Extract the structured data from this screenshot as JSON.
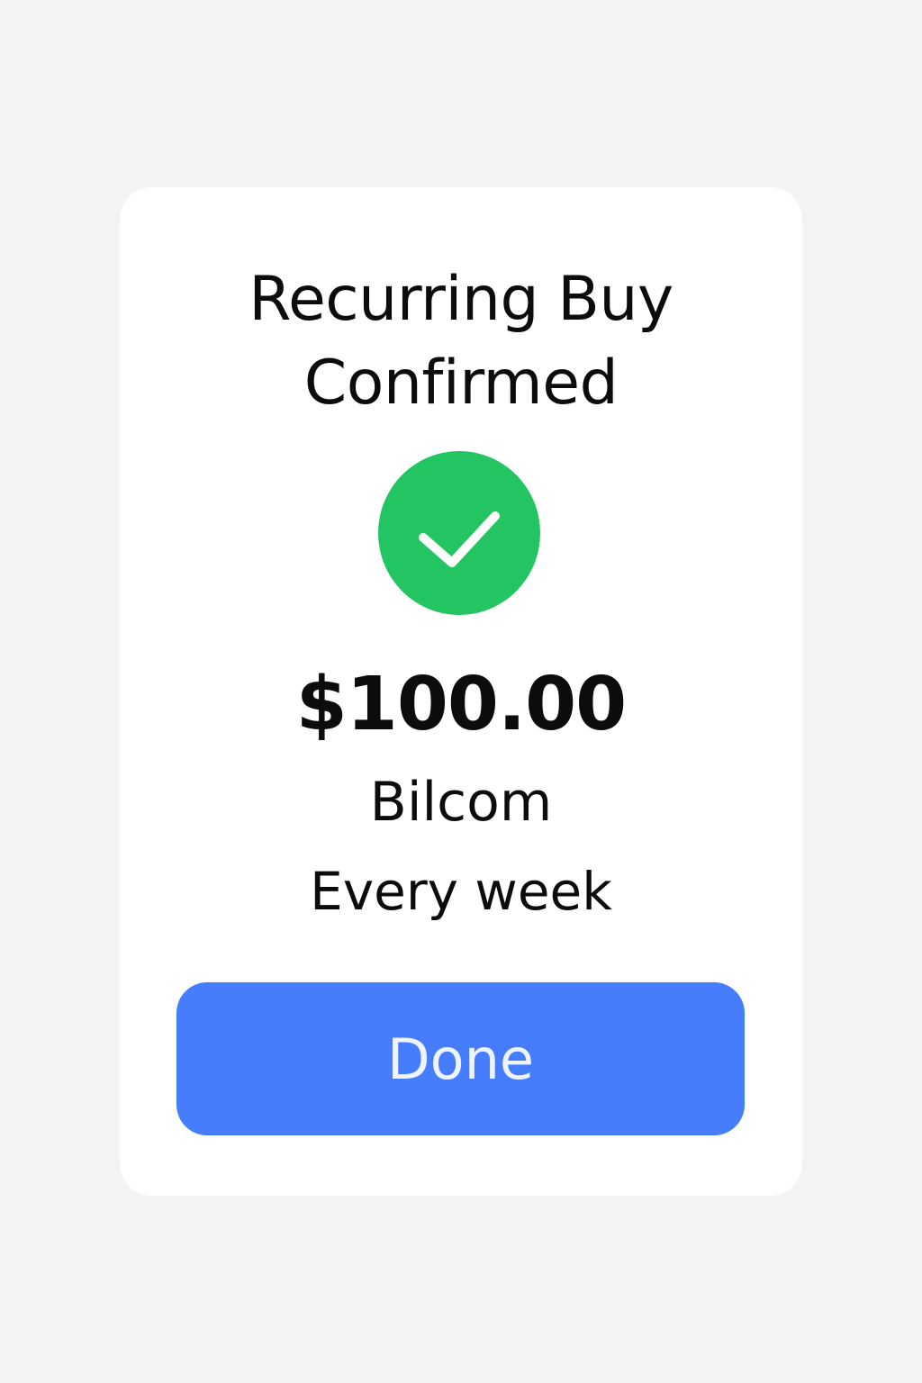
{
  "dialog": {
    "title_line_1": "Recurring Buy",
    "title_line_2": "Confirmed",
    "status_icon": "check-circle-icon",
    "amount": "$100.00",
    "asset": "Bilcom",
    "frequency": "Every week",
    "done_label": "Done"
  },
  "colors": {
    "background": "#f4f3f1",
    "card": "#ffffff",
    "success": "#22c562",
    "button": "#457dfc",
    "text": "#0c0c0c"
  }
}
